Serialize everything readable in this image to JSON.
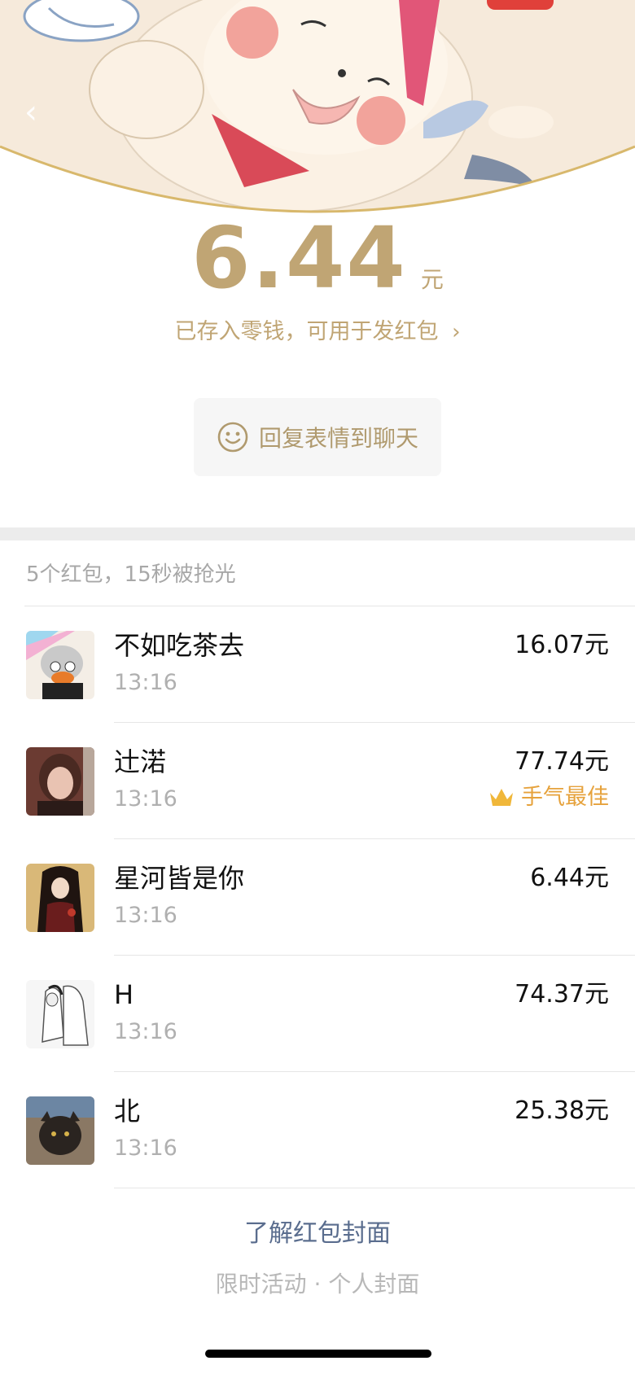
{
  "header": {
    "back_icon": "chevron-left-icon"
  },
  "received": {
    "amount": "6.44",
    "unit": "元",
    "stored_text": "已存入零钱，可用于发红包",
    "stored_chevron": "›"
  },
  "reply_button": {
    "label": "回复表情到聊天",
    "icon": "smile-icon"
  },
  "summary": "5个红包，15秒被抢光",
  "records": [
    {
      "name": "不如吃茶去",
      "time": "13:16",
      "amount": "16.07元",
      "best": ""
    },
    {
      "name": "辻渃",
      "time": "13:16",
      "amount": "77.74元",
      "best": "手气最佳"
    },
    {
      "name": "星河皆是你",
      "time": "13:16",
      "amount": "6.44元",
      "best": ""
    },
    {
      "name": "H",
      "time": "13:16",
      "amount": "74.37元",
      "best": ""
    },
    {
      "name": "北",
      "time": "13:16",
      "amount": "25.38元",
      "best": ""
    }
  ],
  "footer": {
    "learn_link": "了解红包封面",
    "promo_text": "限时活动 · 个人封面"
  },
  "colors": {
    "gold": "#c0a574",
    "best_orange": "#e6a23c",
    "link_blue": "#5a6d8e"
  }
}
